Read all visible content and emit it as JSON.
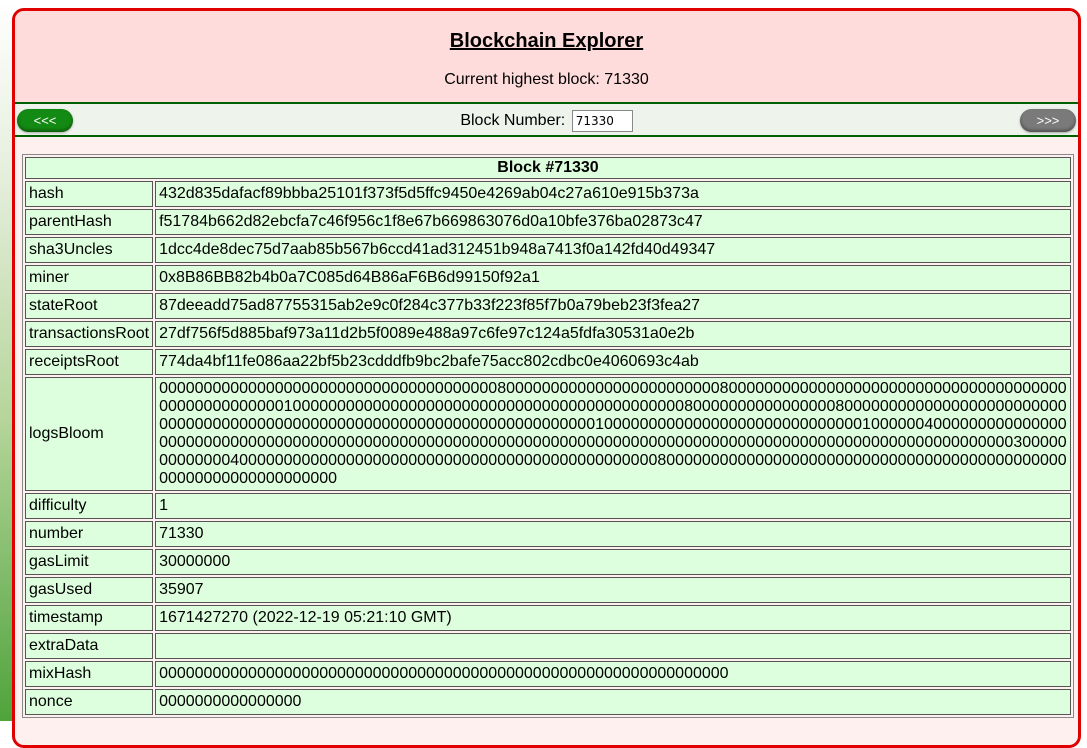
{
  "header": {
    "title": "Blockchain Explorer",
    "current_block_label": "Current highest block: 71330"
  },
  "nav": {
    "prev_label": "<<<",
    "next_label": ">>>",
    "block_number_label": "Block Number:",
    "block_number_value": "71330"
  },
  "block": {
    "caption": "Block #71330",
    "rows": [
      {
        "key": "hash",
        "value": "432d835dafacf89bbba25101f373f5d5ffc9450e4269ab04c27a610e915b373a"
      },
      {
        "key": "parentHash",
        "value": "f51784b662d82ebcfa7c46f956c1f8e67b669863076d0a10bfe376ba02873c47"
      },
      {
        "key": "sha3Uncles",
        "value": "1dcc4de8dec75d7aab85b567b6ccd41ad312451b948a7413f0a142fd40d49347"
      },
      {
        "key": "miner",
        "value": "0x8B86BB82b4b0a7C085d64B86aF6B6d99150f92a1"
      },
      {
        "key": "stateRoot",
        "value": "87deeadd75ad87755315ab2e9c0f284c377b33f223f85f7b0a79beb23f3fea27"
      },
      {
        "key": "transactionsRoot",
        "value": "27df756f5d885baf973a11d2b5f0089e488a97c6fe97c124a5fdfa30531a0e2b"
      },
      {
        "key": "receiptsRoot",
        "value": "774da4bf11fe086aa22bf5b23cdddfb9bc2bafe75acc802cdbc0e4060693c4ab"
      },
      {
        "key": "logsBloom",
        "value": "00000000000000000000000000000000000000800000000000000000000000080000000000000000000000000000000000000000000000000000100000000000000000000000000000000000000000000800000000000000008000000000000000000000000000000000000000000000000000000000000000000000000001000000000000000000000000000001000000400000000000000000000000000000000000000000000000000000000000000000000000000000000000000000000000000000000000000030000000000000400000000000000000000000000000000000000000000000800000000000000000000000000000000000000000000000000000000000000000"
      },
      {
        "key": "difficulty",
        "value": "1"
      },
      {
        "key": "number",
        "value": "71330"
      },
      {
        "key": "gasLimit",
        "value": "30000000"
      },
      {
        "key": "gasUsed",
        "value": "35907"
      },
      {
        "key": "timestamp",
        "value": "1671427270 (2022-12-19 05:21:10 GMT)"
      },
      {
        "key": "extraData",
        "value": ""
      },
      {
        "key": "mixHash",
        "value": "0000000000000000000000000000000000000000000000000000000000000000"
      },
      {
        "key": "nonce",
        "value": "0000000000000000"
      }
    ]
  }
}
